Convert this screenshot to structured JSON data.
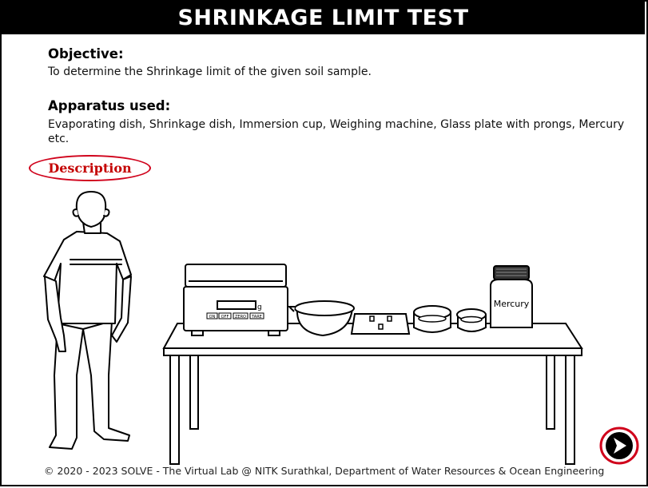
{
  "title": "SHRINKAGE LIMIT TEST",
  "objective": {
    "heading": "Objective:",
    "text": "To determine the Shrinkage limit of the given soil sample."
  },
  "apparatus": {
    "heading": "Apparatus used:",
    "text": "Evaporating dish, Shrinkage dish, Immersion cup, Weighing machine, Glass plate with prongs, Mercury etc."
  },
  "description_button": "Description",
  "scale": {
    "unit": "g",
    "buttons": [
      "ON",
      "OFF",
      "ZERO",
      "TARE"
    ]
  },
  "mercury_label": "Mercury",
  "footer": "© 2020 - 2023 SOLVE - The Virtual Lab @ NITK Surathkal, Department of Water Resources & Ocean Engineering",
  "next_button": {
    "icon": "arrow-right-icon",
    "accent": "#d0021b"
  }
}
